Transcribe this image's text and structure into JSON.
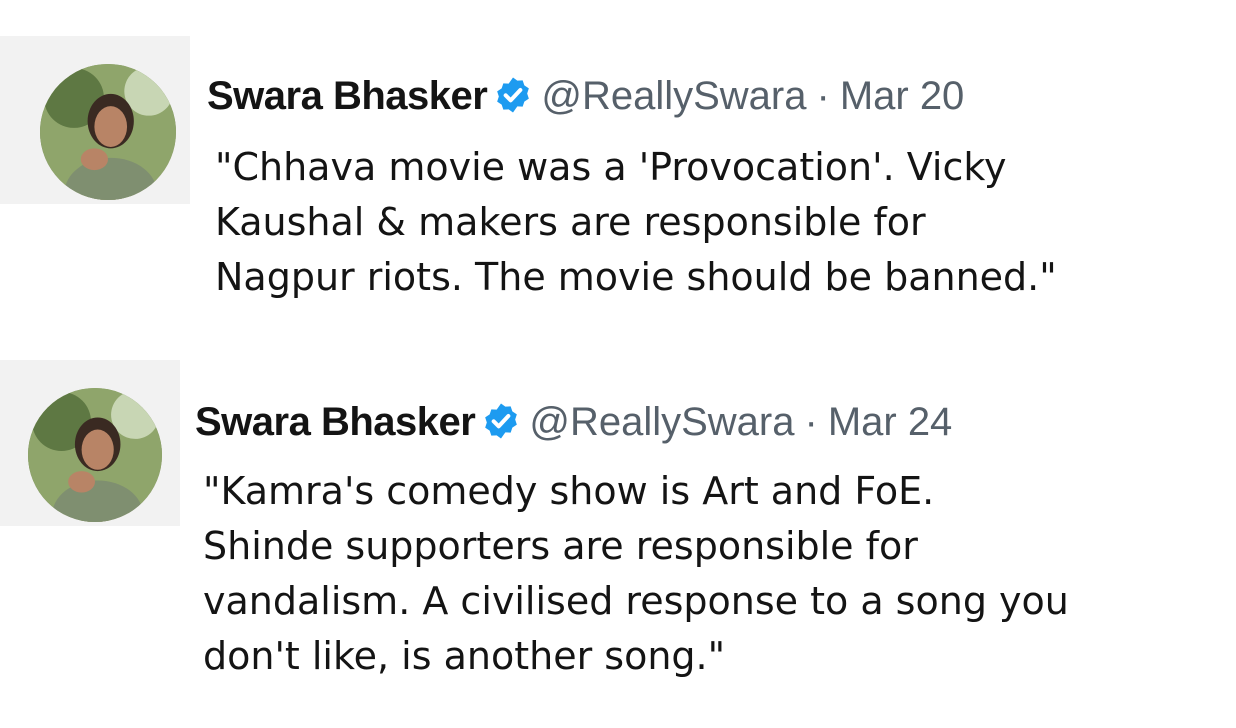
{
  "tweets": [
    {
      "author": {
        "name": "Swara Bhasker",
        "handle": "@ReallySwara",
        "verified": true,
        "avatar_icon": "profile-photo"
      },
      "separator": "·",
      "date": "Mar 20",
      "text": "\"Chhava movie was a 'Provocation'. Vicky\nKaushal & makers are responsible for\nNagpur riots. The movie should be banned.\""
    },
    {
      "author": {
        "name": "Swara Bhasker",
        "handle": "@ReallySwara",
        "verified": true,
        "avatar_icon": "profile-photo"
      },
      "separator": "·",
      "date": "Mar 24",
      "text": "\"Kamra's comedy show is Art and FoE.\nShinde supporters are responsible for\nvandalism. A civilised response to a song you\ndon't like, is another song.\""
    }
  ],
  "colors": {
    "verified_badge": "#1d9bf0",
    "secondary_text": "#56606a",
    "primary_text": "#141414"
  }
}
